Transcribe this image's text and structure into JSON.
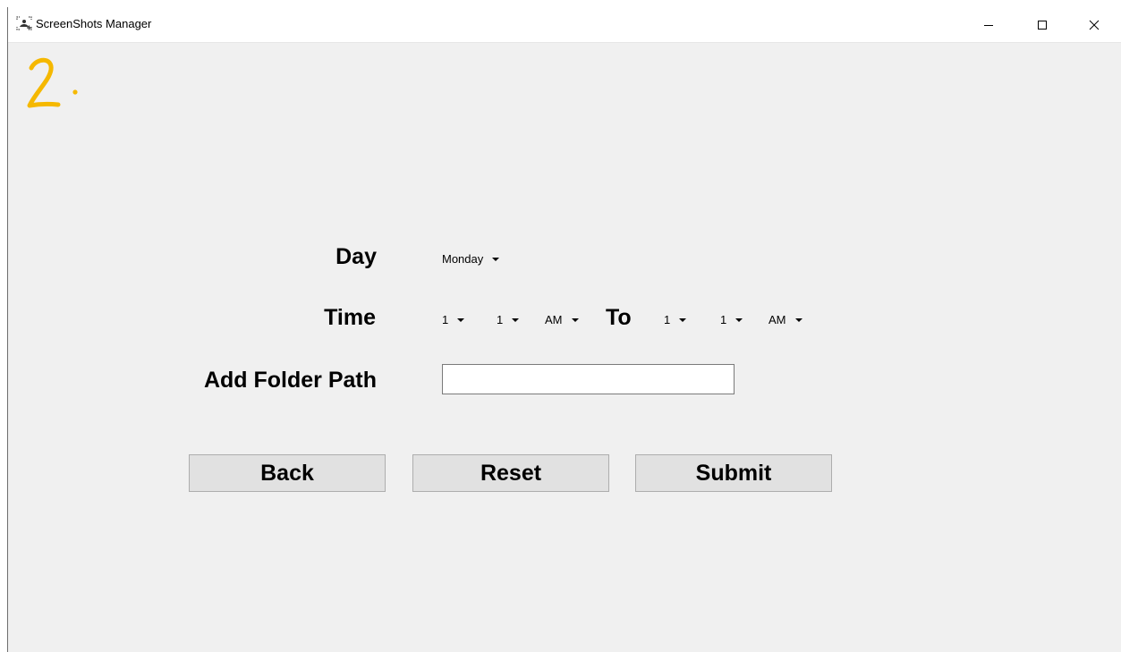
{
  "window": {
    "title": "ScreenShots Manager",
    "icon": "screenshot-app-icon",
    "controls": [
      "minimize-icon",
      "maximize-icon",
      "close-icon"
    ]
  },
  "annotation": {
    "text": "2.",
    "color": "#f5b800"
  },
  "form": {
    "day_label": "Day",
    "day_value": "Monday",
    "time_label": "Time",
    "time_from": {
      "hour": "1",
      "minute": "1",
      "ampm": "AM"
    },
    "to_label": "To",
    "time_to": {
      "hour": "1",
      "minute": "1",
      "ampm": "AM"
    },
    "folder_label": "Add Folder Path",
    "folder_value": "",
    "folder_placeholder": ""
  },
  "buttons": {
    "back": "Back",
    "reset": "Reset",
    "submit": "Submit"
  }
}
